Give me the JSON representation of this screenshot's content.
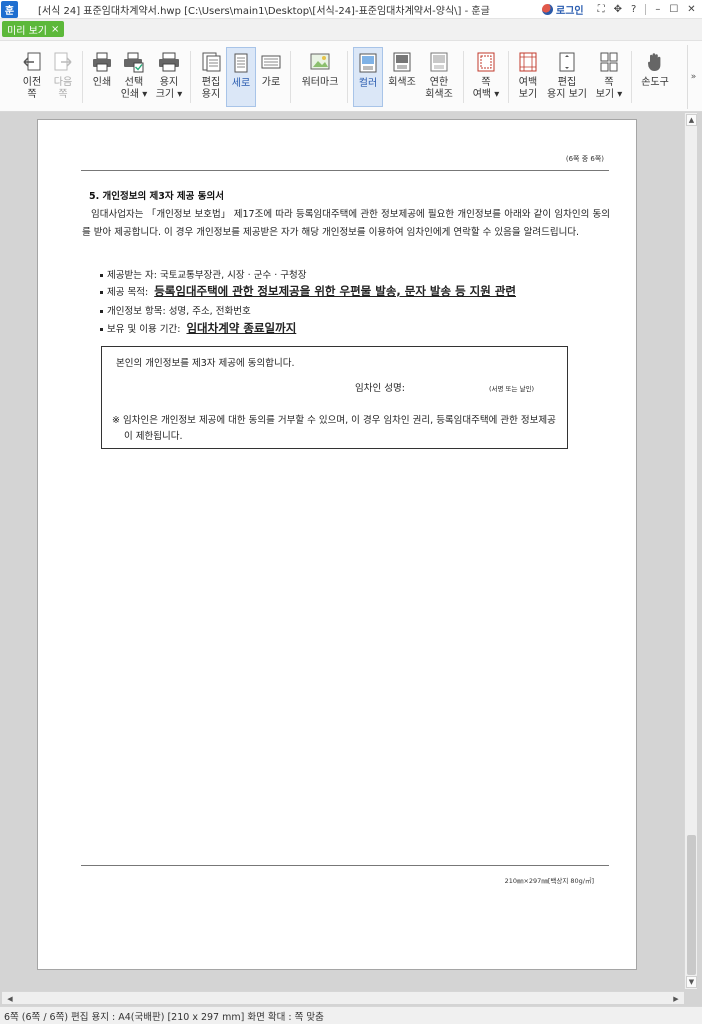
{
  "window": {
    "app_icon_label": "훈",
    "title": "[서식 24] 표준임대차계약서.hwp [C:\\Users\\main1\\Desktop\\[서식-24]-표준임대차계약서-양식\\] - 훈글",
    "login_label": "로그인",
    "controls": {
      "fullscreen": "⛶",
      "move": "✥",
      "help": "?",
      "minimize": "–",
      "maximize": "☐",
      "close": "✕"
    }
  },
  "tab": {
    "label": "미리 보기",
    "close": "×"
  },
  "ribbon": {
    "buttons": [
      {
        "id": "prev",
        "label1": "이전",
        "label2": "쪽",
        "icon": "prev-page-icon"
      },
      {
        "id": "next",
        "label1": "다음",
        "label2": "쪽",
        "icon": "next-page-icon"
      },
      {
        "id": "print",
        "label1": "인쇄",
        "label2": "",
        "icon": "printer-icon"
      },
      {
        "id": "print-select",
        "label1": "선택",
        "label2": "인쇄 ▾",
        "icon": "print-select-icon"
      },
      {
        "id": "paper-size",
        "label1": "용지",
        "label2": "크기 ▾",
        "icon": "paper-size-icon"
      },
      {
        "id": "edit-paper",
        "label1": "편집",
        "label2": "용지",
        "icon": "edit-paper-icon"
      },
      {
        "id": "portrait",
        "label1": "세로",
        "label2": "",
        "icon": "portrait-icon"
      },
      {
        "id": "landscape",
        "label1": "가로",
        "label2": "",
        "icon": "landscape-icon"
      },
      {
        "id": "watermark",
        "label1": "워터마크",
        "label2": "",
        "icon": "watermark-icon"
      },
      {
        "id": "color",
        "label1": "컬러",
        "label2": "",
        "icon": "color-icon"
      },
      {
        "id": "grayscale",
        "label1": "회색조",
        "label2": "",
        "icon": "grayscale-icon"
      },
      {
        "id": "light-gray",
        "label1": "연한",
        "label2": "회색조",
        "icon": "light-gray-icon"
      },
      {
        "id": "page-margin",
        "label1": "쪽",
        "label2": "여백 ▾",
        "icon": "page-margin-icon"
      },
      {
        "id": "margin-view",
        "label1": "여백",
        "label2": "보기",
        "icon": "margin-view-icon"
      },
      {
        "id": "edit-paper-view",
        "label1": "편집",
        "label2": "용지 보기",
        "icon": "edit-paper-view-icon"
      },
      {
        "id": "page-view",
        "label1": "쪽",
        "label2": "보기 ▾",
        "icon": "page-view-icon"
      },
      {
        "id": "hand-tool",
        "label1": "손도구",
        "label2": "",
        "icon": "hand-icon"
      }
    ],
    "more": "»"
  },
  "document": {
    "page_number": "(6쪽 중 6쪽)",
    "section_title": "5. 개인정보의 제3자 제공 동의서",
    "paragraph": "임대사업자는 「개인정보 보호법」 제17조에 따라 등록임대주택에 관한 정보제공에 필요한 개인정보를 아래와 같이 임차인의 동의를 받아 제공합니다. 이 경우 개인정보를 제공받은 자가 해당 개인정보를 이용하여 임차인에게 연락할 수 있음을 알려드립니다.",
    "bullets": [
      {
        "label": "제공받는 자: ",
        "value": "국토교통부장관, 시장 · 군수 · 구청장",
        "emphasis": false
      },
      {
        "label": "제공 목적: ",
        "value": "등록임대주택에 관한 정보제공을 위한 우편물 발송, 문자 발송 등 지원 관련",
        "emphasis": true
      },
      {
        "label": "개인정보 항목: ",
        "value": "성명, 주소, 전화번호",
        "emphasis": false
      },
      {
        "label": "보유 및 이용 기간: ",
        "value": "임대차계약 종료일까지",
        "emphasis": true
      }
    ],
    "consent_box": {
      "statement": "본인의 개인정보를 제3자 제공에 동의합니다.",
      "sign_label": "임차인 성명:",
      "sign_hint": "(서명 또는 날인)",
      "note": "※ 임차인은 개인정보 제공에 대한 동의를 거부할 수 있으며, 이 경우 임차인 권리, 등록임대주택에 관한 정보제공이 제한됩니다."
    },
    "footer": "210㎜×297㎜[백상지 80g/㎡]"
  },
  "statusbar": {
    "text": "6쪽 (6쪽 / 6쪽) 편집 용지 : A4(국배판) [210 x 297 mm] 화면 확대 : 쪽 맞춤"
  }
}
